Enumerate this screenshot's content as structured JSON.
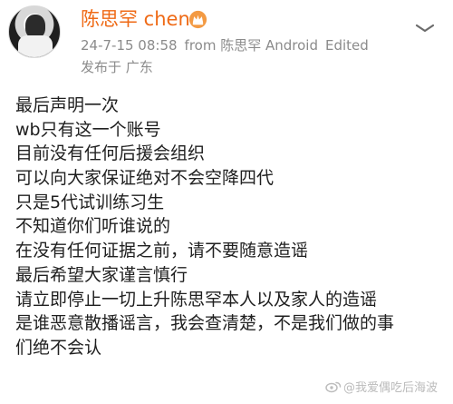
{
  "profile": {
    "user_name": "陈思罕 chen",
    "timestamp": "24-7-15 08:58",
    "source": "from 陈思罕 Android",
    "edited_label": "Edited",
    "location": "发布于 广东",
    "verified_icon": "crown-badge-icon"
  },
  "post": {
    "lines": [
      "最后声明一次",
      "wb只有这一个账号",
      "目前没有任何后援会组织",
      "可以向大家保证绝对不会空降四代",
      "只是5代试训练习生",
      "不知道你们听谁说的",
      "在没有任何证据之前，请不要随意造谣",
      "最后希望大家谨言慎行",
      "请立即停止一切上升陈思罕本人以及家人的造谣",
      "是谁恶意散播谣言，我会查清楚，不是我们做的事",
      "们绝不会认"
    ]
  },
  "watermark": {
    "text": "@我爱偶吃后海波"
  },
  "colors": {
    "user_name": "#ef6a16",
    "meta": "#8b8b8b",
    "body_text": "#202020"
  }
}
